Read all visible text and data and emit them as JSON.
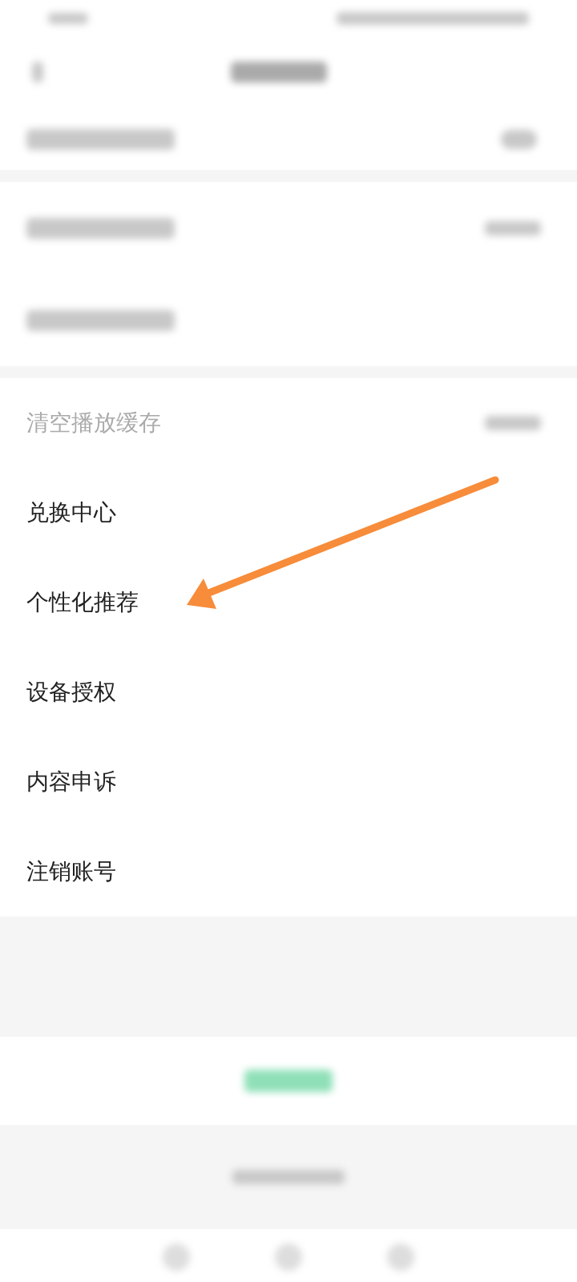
{
  "rows": [
    {
      "label": "清空播放缓存",
      "kind": "dimmed"
    },
    {
      "label": "兑换中心",
      "kind": "normal"
    },
    {
      "label": "个性化推荐",
      "kind": "normal"
    },
    {
      "label": "设备授权",
      "kind": "normal"
    },
    {
      "label": "内容申诉",
      "kind": "normal"
    },
    {
      "label": "注销账号",
      "kind": "normal"
    }
  ]
}
